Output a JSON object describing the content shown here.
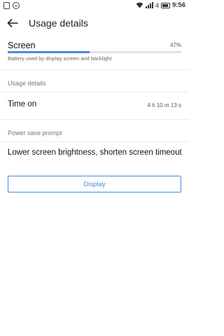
{
  "status_bar": {
    "battery_level": "4",
    "time": "9:56"
  },
  "header": {
    "title": "Usage details"
  },
  "screen_item": {
    "label": "Screen",
    "percent": "47%",
    "usage_fraction": 0.47,
    "description": "Battery used by display screen and backlight"
  },
  "usage_section": {
    "header": "Usage details",
    "time_on_label": "Time on",
    "time_on_value": "4 h 10 m 13 s"
  },
  "power_section": {
    "header": "Power save prompt",
    "tip": "Lower screen brightness, shorten screen timeout"
  },
  "actions": {
    "display_label": "Display"
  },
  "colors": {
    "accent": "#3f8ce0",
    "track": "#e3e3e3"
  }
}
